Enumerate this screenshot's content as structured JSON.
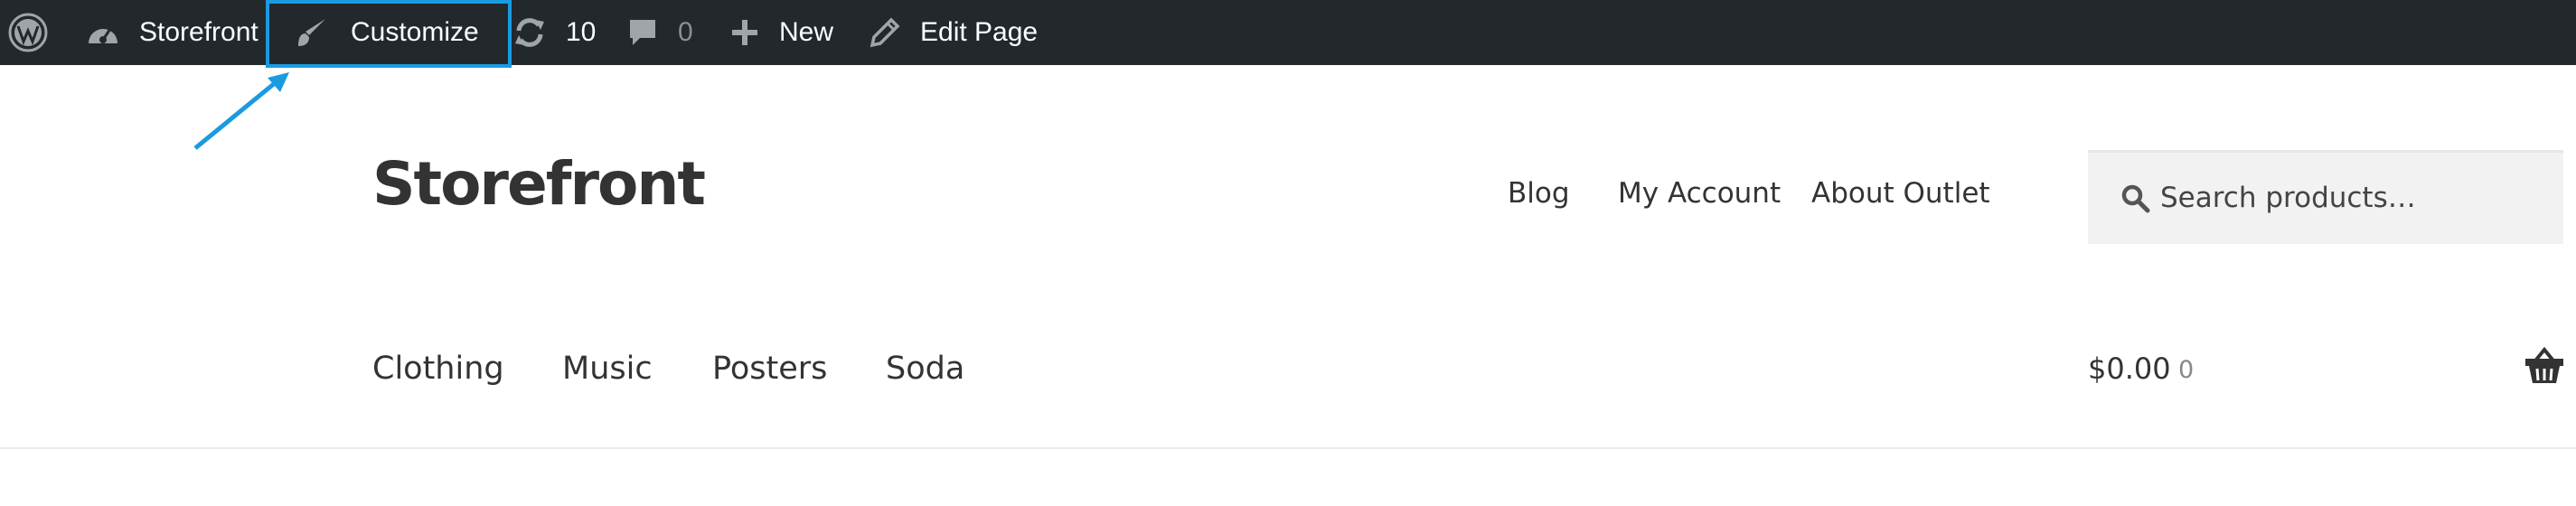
{
  "adminbar": {
    "site_name": "Storefront",
    "customize_label": "Customize",
    "updates_count": "10",
    "comments_count": "0",
    "new_label": "New",
    "edit_label": "Edit Page"
  },
  "header": {
    "site_title": "Storefront",
    "secondary_nav": [
      "Blog",
      "My Account",
      "About Outlet"
    ],
    "search_placeholder": "Search products…"
  },
  "primary_nav": [
    "Clothing",
    "Music",
    "Posters",
    "Soda"
  ],
  "cart": {
    "total": "$0.00",
    "count": "0"
  },
  "colors": {
    "adminbar_bg": "#23282d",
    "highlight": "#1a9be0",
    "text": "#333333"
  },
  "icons": [
    "wordpress-icon",
    "dashboard-icon",
    "brush-icon",
    "updates-icon",
    "comment-icon",
    "plus-icon",
    "pencil-icon",
    "search-icon",
    "basket-icon",
    "annotation-arrow"
  ]
}
